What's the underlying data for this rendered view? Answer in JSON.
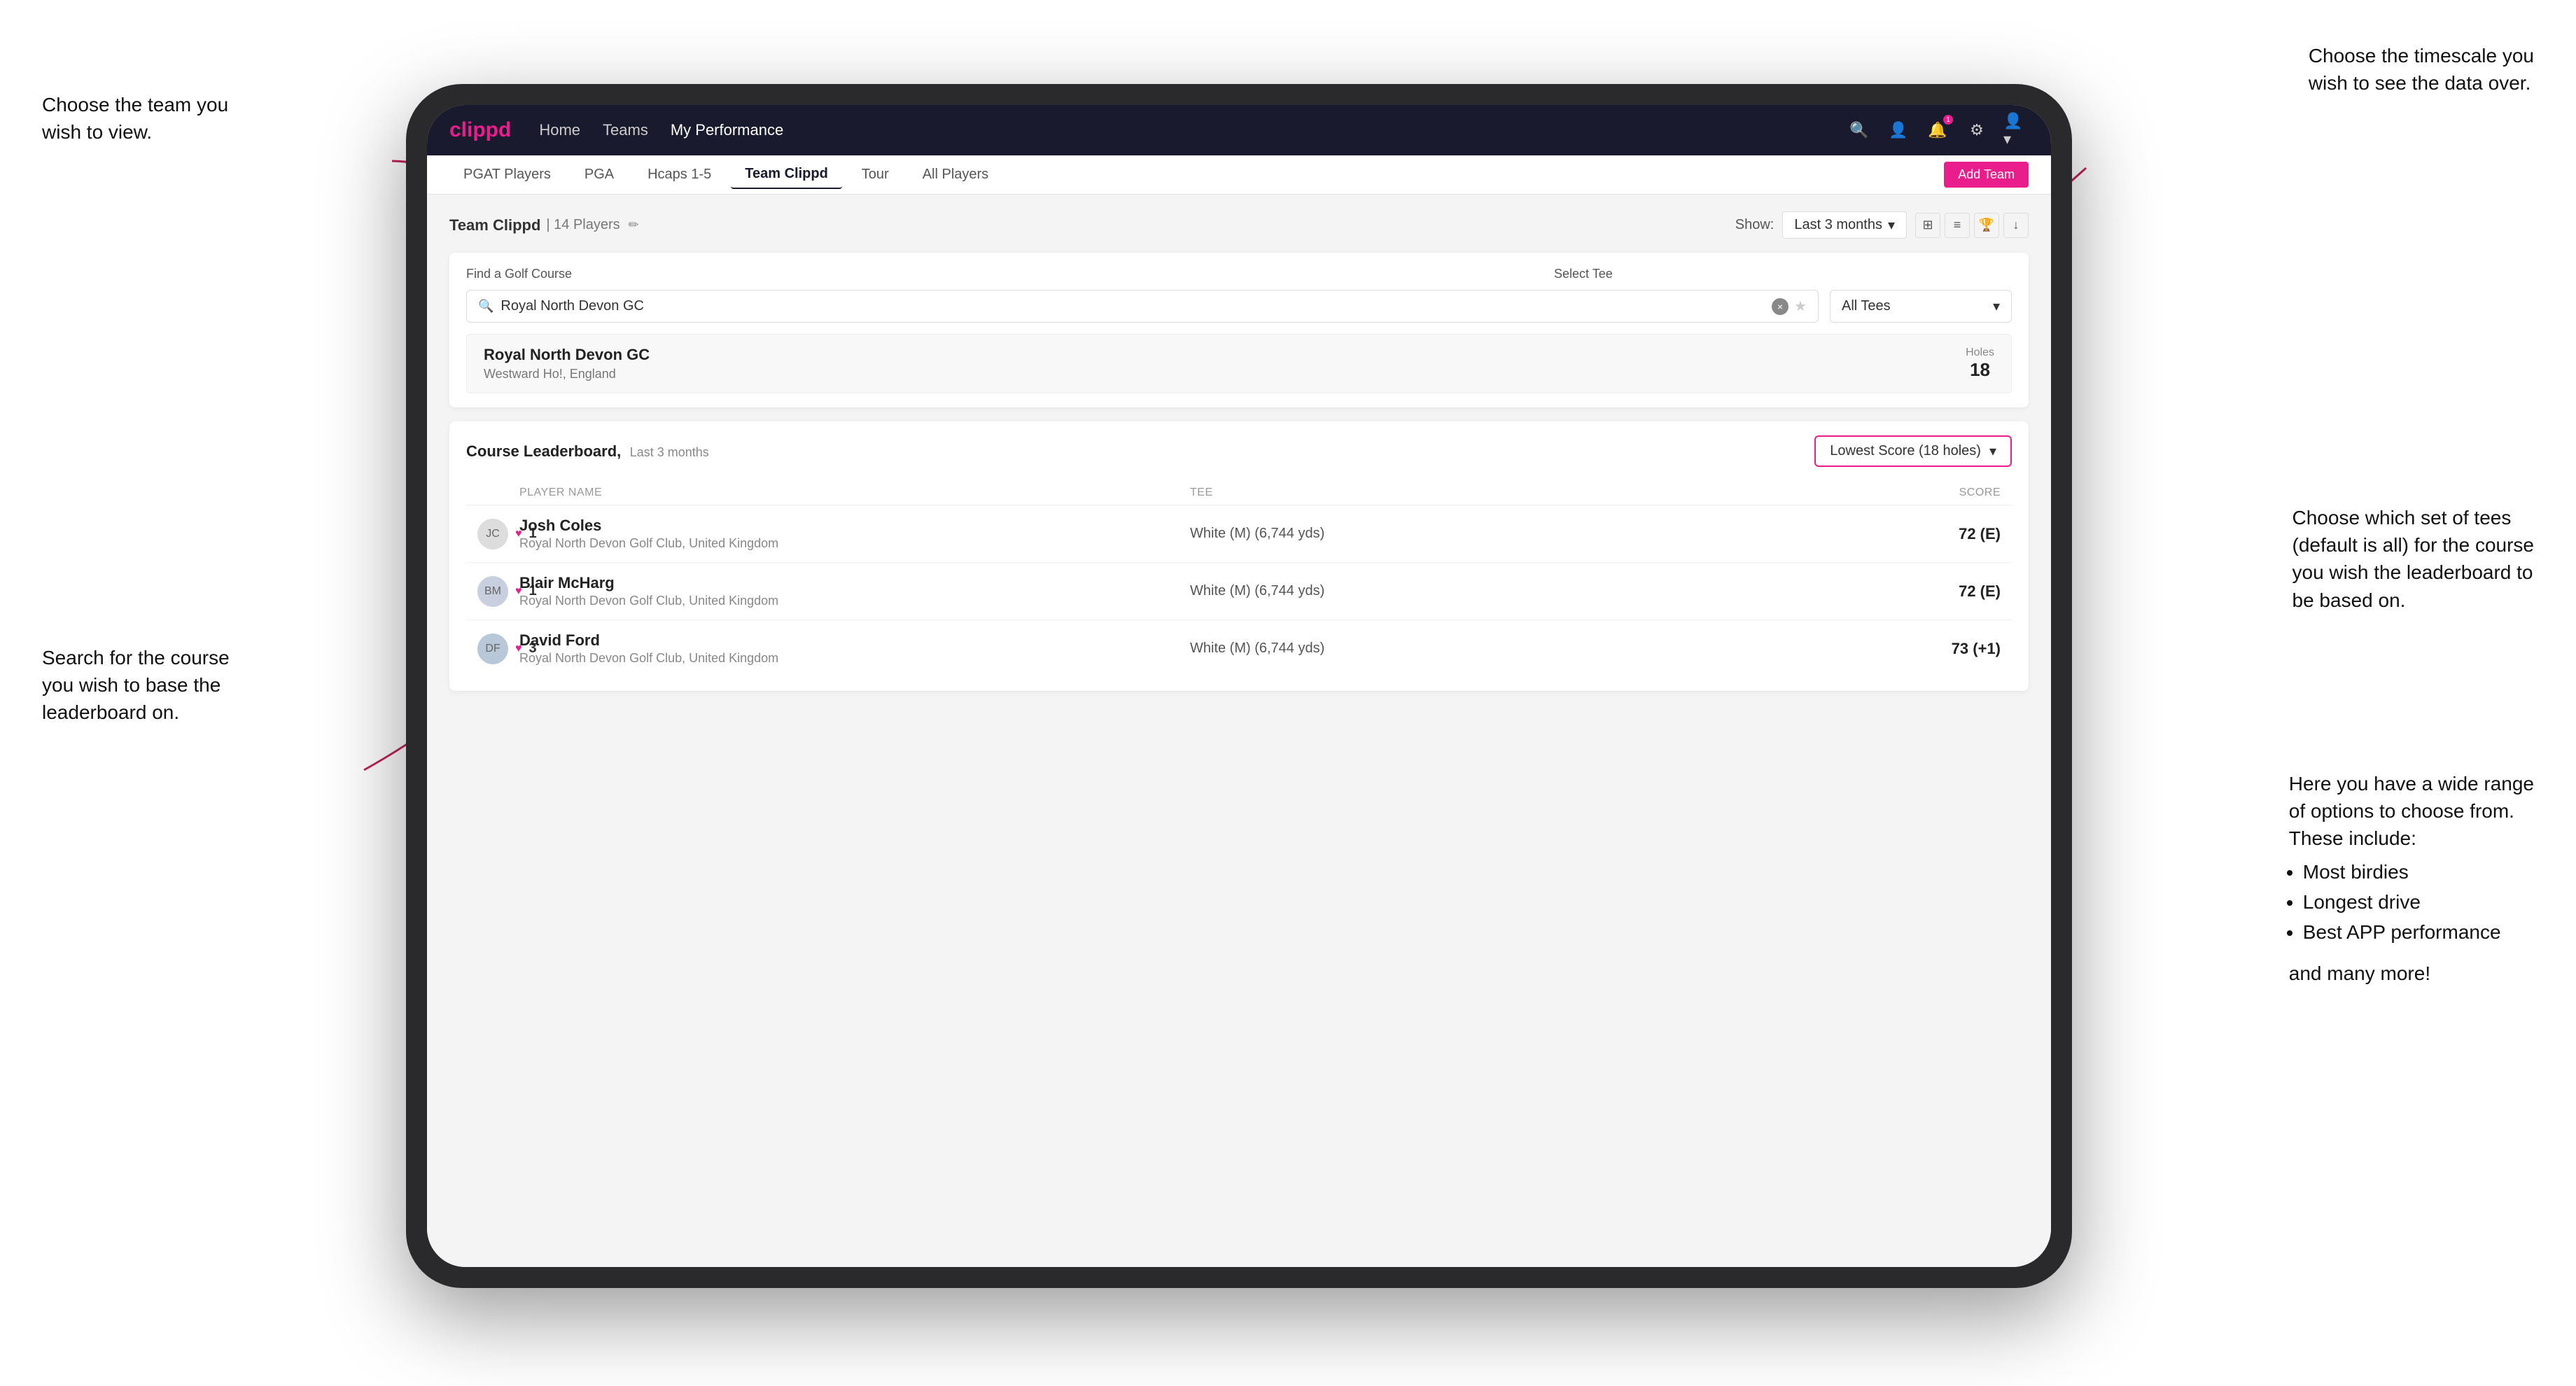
{
  "annotations": {
    "team_choice": "Choose the team you\nwish to view.",
    "timescale_choice": "Choose the timescale you\nwish to see the data over.",
    "tee_choice": "Choose which set of tees\n(default is all) for the course\nyou wish the leaderboard to\nbe based on.",
    "options_intro": "Here you have a wide range\nof options to choose from.\nThese include:",
    "options_list": [
      "Most birdies",
      "Longest drive",
      "Best APP performance"
    ],
    "options_more": "and many more!",
    "course_search": "Search for the course\nyou wish to base the\nleaderboard on."
  },
  "nav": {
    "logo": "clippd",
    "links": [
      "Home",
      "Teams",
      "My Performance"
    ],
    "active_link": "My Performance"
  },
  "sub_nav": {
    "items": [
      "PGAT Players",
      "PGA",
      "Hcaps 1-5",
      "Team Clippd",
      "Tour",
      "All Players"
    ],
    "active_item": "Team Clippd",
    "add_team_label": "Add Team"
  },
  "team_header": {
    "title": "Team Clippd",
    "count": "| 14 Players",
    "show_label": "Show:",
    "show_value": "Last 3 months"
  },
  "search": {
    "find_label": "Find a Golf Course",
    "select_tee_label": "Select Tee",
    "placeholder": "Royal North Devon GC",
    "tee_value": "All Tees"
  },
  "course_result": {
    "name": "Royal North Devon GC",
    "location": "Westward Ho!, England",
    "holes_label": "Holes",
    "holes_value": "18"
  },
  "leaderboard": {
    "title": "Course Leaderboard,",
    "subtitle": "Last 3 months",
    "score_type": "Lowest Score (18 holes)",
    "col_headers": [
      "",
      "PLAYER NAME",
      "TEE",
      "SCORE"
    ],
    "rows": [
      {
        "rank": "1",
        "name": "Josh Coles",
        "club": "Royal North Devon Golf Club, United Kingdom",
        "tee": "White (M) (6,744 yds)",
        "score": "72 (E)"
      },
      {
        "rank": "1",
        "name": "Blair McHarg",
        "club": "Royal North Devon Golf Club, United Kingdom",
        "tee": "White (M) (6,744 yds)",
        "score": "72 (E)"
      },
      {
        "rank": "3",
        "name": "David Ford",
        "club": "Royal North Devon Golf Club, United Kingdom",
        "tee": "White (M) (6,744 yds)",
        "score": "73 (+1)"
      }
    ]
  },
  "icons": {
    "search": "🔍",
    "star": "★",
    "edit": "✏",
    "chevron_down": "▾",
    "grid": "⊞",
    "list": "≡",
    "trophy": "🏆",
    "download": "↓",
    "heart": "♥",
    "clear": "×",
    "notification": "🔔",
    "user": "👤",
    "settings": "⚙",
    "profile": "👤"
  },
  "colors": {
    "brand_pink": "#e91e8c",
    "nav_dark": "#1a1a2e",
    "accent_border": "#e91e8c"
  }
}
